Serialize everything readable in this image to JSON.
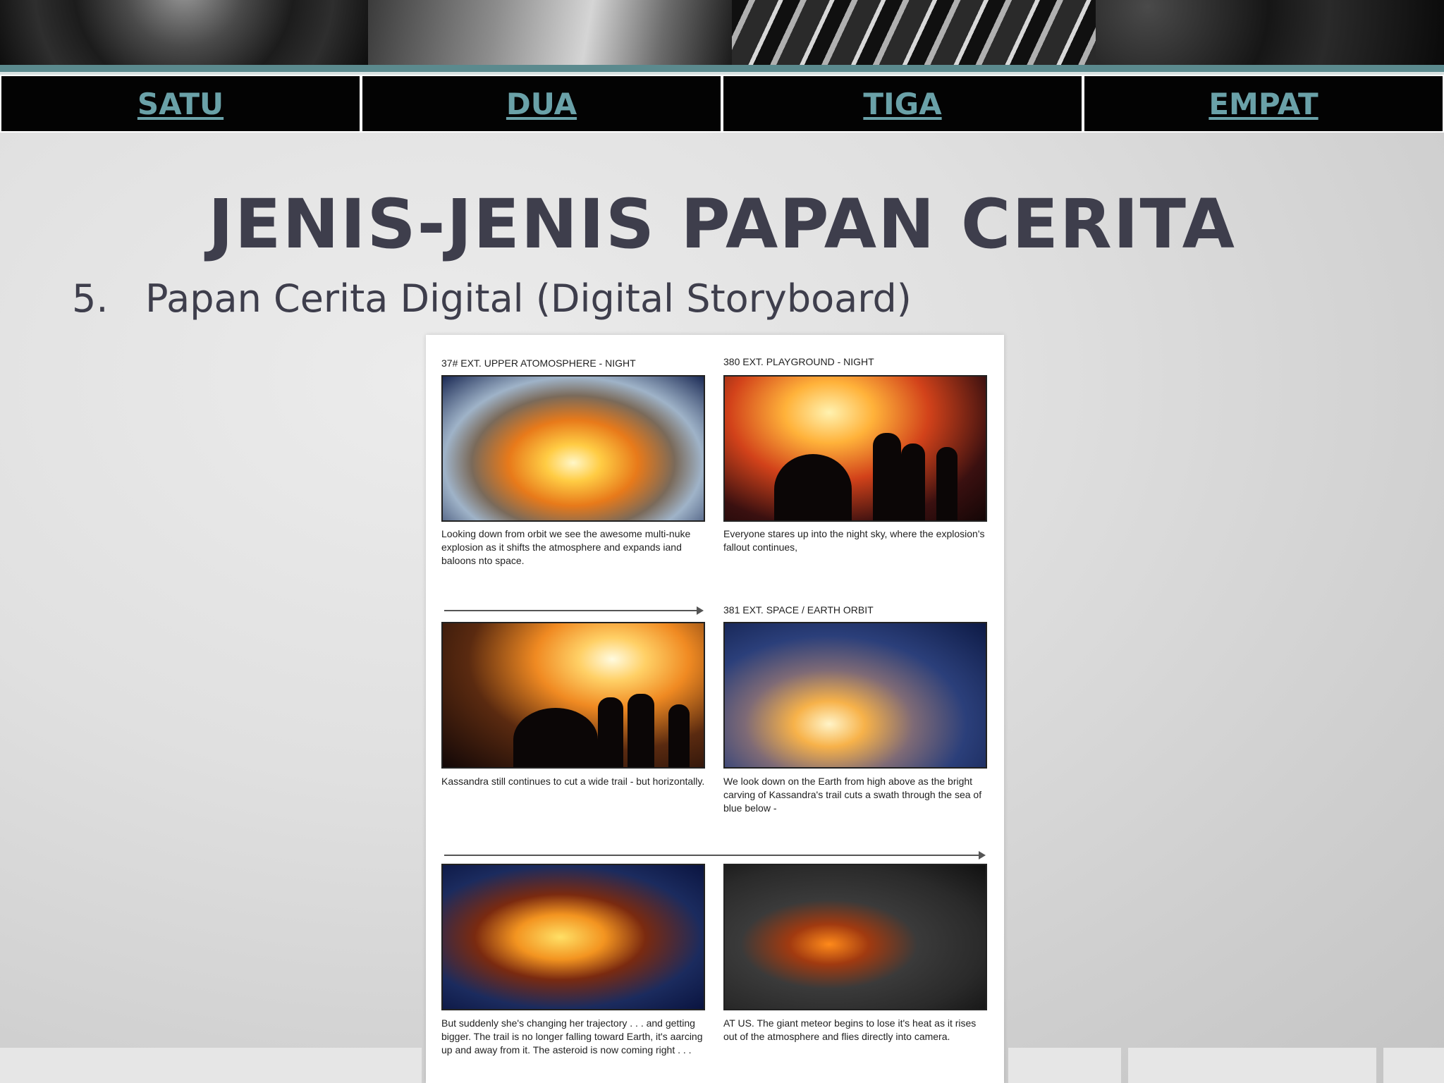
{
  "nav": {
    "items": [
      {
        "label": "SATU"
      },
      {
        "label": "DUA"
      },
      {
        "label": "TIGA"
      },
      {
        "label": "EMPAT"
      }
    ]
  },
  "slide": {
    "title": "JENIS-JENIS PAPAN CERITA",
    "item_number": "5.",
    "item_text": "Papan Cerita Digital (Digital Storyboard)"
  },
  "storyboard": {
    "panels": [
      {
        "scene": "37# EXT. UPPER ATOMOSPHERE - NIGHT",
        "caption": "Looking down from orbit we see the awesome multi-nuke explosion as it shifts the atmosphere and expands iand baloons nto space."
      },
      {
        "scene": "380 EXT. PLAYGROUND - NIGHT",
        "caption": "Everyone stares up into the night sky, where the explosion's fallout continues,"
      },
      {
        "scene": "",
        "caption": "Kassandra still continues to cut a wide trail - but horizontally."
      },
      {
        "scene": "381 EXT. SPACE / EARTH ORBIT",
        "caption": "We look down on the Earth from high above as the bright carving of Kassandra's trail cuts a swath through the sea of blue below -"
      },
      {
        "scene": "",
        "caption": "But suddenly she's changing her trajectory . . . and getting bigger. The trail is no longer falling toward Earth, it's aarcing up and away from it. The asteroid is now coming right . . ."
      },
      {
        "scene": "",
        "caption": "AT US. The giant meteor begins to lose it's heat as it rises out of the atmosphere and flies directly into camera."
      }
    ]
  }
}
